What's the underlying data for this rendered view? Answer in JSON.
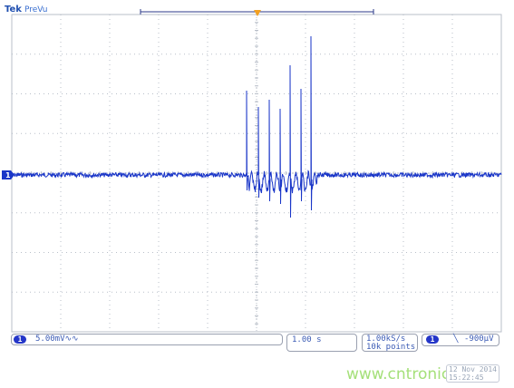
{
  "brand": {
    "name": "Tek",
    "mode": "PreVu"
  },
  "channel1": {
    "label": "1",
    "marker": "1",
    "scale": "5.00mV",
    "coupling_symbol": "∿∿",
    "color": "#1a36c8"
  },
  "horizontal": {
    "timebase": "1.00 s",
    "sample_rate": "1.00kS/s",
    "record_length": "10k points",
    "trigger_marker": "T"
  },
  "trigger": {
    "channel": "1",
    "slope_symbol": "╲",
    "level": "-900µV"
  },
  "timestamp": {
    "date": "12 Nov 2014",
    "time": "15:22:45"
  },
  "watermark": "www.cntronics.com",
  "colors": {
    "grid": "#b9bfc9",
    "trace": "#1a36c8",
    "accent": "#f2a020"
  }
}
